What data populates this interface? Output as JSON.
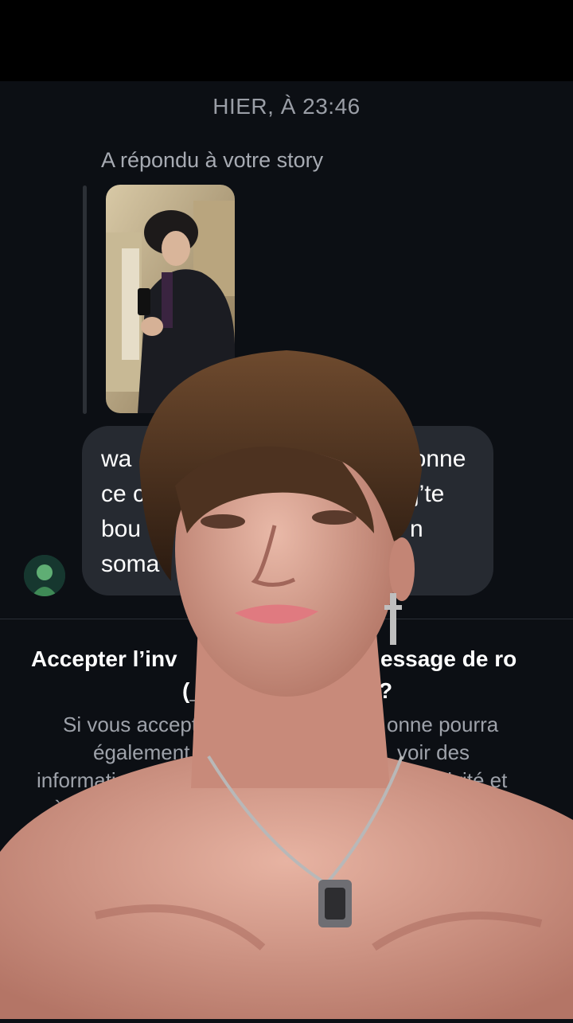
{
  "header": {
    "timestamp": "HIER, À 23:46"
  },
  "story_reply": {
    "label": "A répondu à votre story"
  },
  "message": {
    "line1_left": "wa",
    "line1_right": "lonne",
    "line2_left": "ce c",
    "line2_right": "j’te",
    "line3_left": "bou",
    "line3_right": "n",
    "line4_left": "soma"
  },
  "invite": {
    "title_line1_left": "Accepter l’inv",
    "title_line1_right": "essage de ro",
    "title_line2_left": "(_r",
    "title_line2_right": "?",
    "info_line1_left": "Si vous accept",
    "info_line1_right": "onne pourra",
    "info_line2_left": "également",
    "info_line2_right": "voir des",
    "info_line3_left": "informations",
    "info_line3_right": "tivité et",
    "info_line4_left": "à quel"
  },
  "colors": {
    "background": "#0c0f14",
    "bubble": "#262a31",
    "skin": "#d9998a"
  }
}
